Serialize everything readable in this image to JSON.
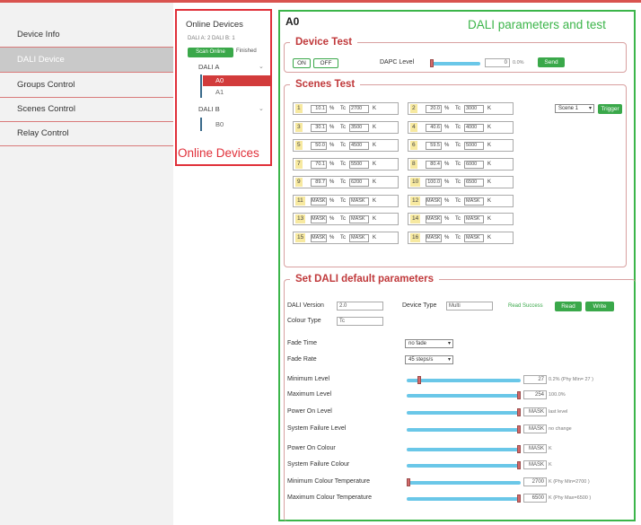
{
  "sidebar": {
    "items": [
      {
        "label": "Device Info",
        "active": false
      },
      {
        "label": "DALI Device",
        "active": true
      },
      {
        "label": "Groups Control",
        "active": false
      },
      {
        "label": "Scenes Control",
        "active": false
      },
      {
        "label": "Relay Control",
        "active": false
      }
    ]
  },
  "tree": {
    "title": "Online Devices",
    "addresses": "DALI A: 2   DALI B: 1",
    "scan_label": "Scan Online",
    "scan_status": "Finished",
    "bus_a": "DALI A",
    "bus_b": "DALI B",
    "devices_a": [
      "A0",
      "A1"
    ],
    "devices_b": [
      "B0"
    ],
    "selected": "A0",
    "annotation": "Online Devices"
  },
  "main": {
    "device_title": "A0",
    "annotation": "DALI parameters and test",
    "device_test": {
      "legend": "Device Test",
      "on_label": "ON",
      "off_label": "OFF",
      "dapc_label": "DAPC Level",
      "dapc_value": "0",
      "dapc_percent": "0.0%",
      "dapc_level_fraction": 0.0,
      "send_label": "Send"
    },
    "scenes_test": {
      "legend": "Scenes Test",
      "scene_select": "Scene 1",
      "trigger_label": "Trigger",
      "pct_unit": "%",
      "tc_label": "Tc",
      "k_unit": "K",
      "scenes": [
        {
          "num": "1",
          "level": "10.1",
          "tc": "2700"
        },
        {
          "num": "2",
          "level": "20.0",
          "tc": "3000"
        },
        {
          "num": "3",
          "level": "30.1",
          "tc": "3500"
        },
        {
          "num": "4",
          "level": "40.6",
          "tc": "4000"
        },
        {
          "num": "5",
          "level": "50.0",
          "tc": "4500"
        },
        {
          "num": "6",
          "level": "59.5",
          "tc": "5000"
        },
        {
          "num": "7",
          "level": "70.1",
          "tc": "5500"
        },
        {
          "num": "8",
          "level": "80.4",
          "tc": "6000"
        },
        {
          "num": "9",
          "level": "89.7",
          "tc": "6200"
        },
        {
          "num": "10",
          "level": "100.0",
          "tc": "6500"
        },
        {
          "num": "11",
          "level": "MASK",
          "tc": "MASK"
        },
        {
          "num": "12",
          "level": "MASK",
          "tc": "MASK"
        },
        {
          "num": "13",
          "level": "MASK",
          "tc": "MASK"
        },
        {
          "num": "14",
          "level": "MASK",
          "tc": "MASK"
        },
        {
          "num": "15",
          "level": "MASK",
          "tc": "MASK"
        },
        {
          "num": "16",
          "level": "MASK",
          "tc": "MASK"
        }
      ]
    },
    "defaults": {
      "legend": "Set DALI default parameters",
      "version_label": "DALI Version",
      "version_value": "2.0",
      "device_type_label": "Device Type",
      "device_type_value": "Multi",
      "colour_type_label": "Colour Type",
      "colour_type_value": "Tc",
      "read_status": "Read Success",
      "read_label": "Read",
      "write_label": "Write",
      "fade_time_label": "Fade Time",
      "fade_time_value": "no fade",
      "fade_rate_label": "Fade Rate",
      "fade_rate_value": "45 steps/s",
      "params": [
        {
          "label": "Minimum Level",
          "value": "27",
          "note": "0.2%    (Phy Min= 27 )",
          "fraction": 0.1
        },
        {
          "label": "Maximum Level",
          "value": "254",
          "note": "100.0%",
          "fraction": 1.0
        },
        {
          "label": "Power On Level",
          "value": "MASK",
          "note": "last level",
          "fraction": 1.0
        },
        {
          "label": "System Failure Level",
          "value": "MASK",
          "note": "no change",
          "fraction": 1.0
        },
        {
          "label": "Power On Colour",
          "value": "MASK",
          "note": "K",
          "fraction": 1.0
        },
        {
          "label": "System Failure Colour",
          "value": "MASK",
          "note": "K",
          "fraction": 1.0
        },
        {
          "label": "Minimum Colour Temperature",
          "value": "2700",
          "note": "K  (Phy Min=2700 )",
          "fraction": 0.0
        },
        {
          "label": "Maximum Colour Temperature",
          "value": "6500",
          "note": "K  (Phy Max=6500 )",
          "fraction": 1.0
        }
      ]
    }
  },
  "colors": {
    "accent_red": "#e0303a",
    "accent_green": "#3cb54a",
    "slider": "#6ac7e8",
    "selected_device": "#d23b3b"
  }
}
